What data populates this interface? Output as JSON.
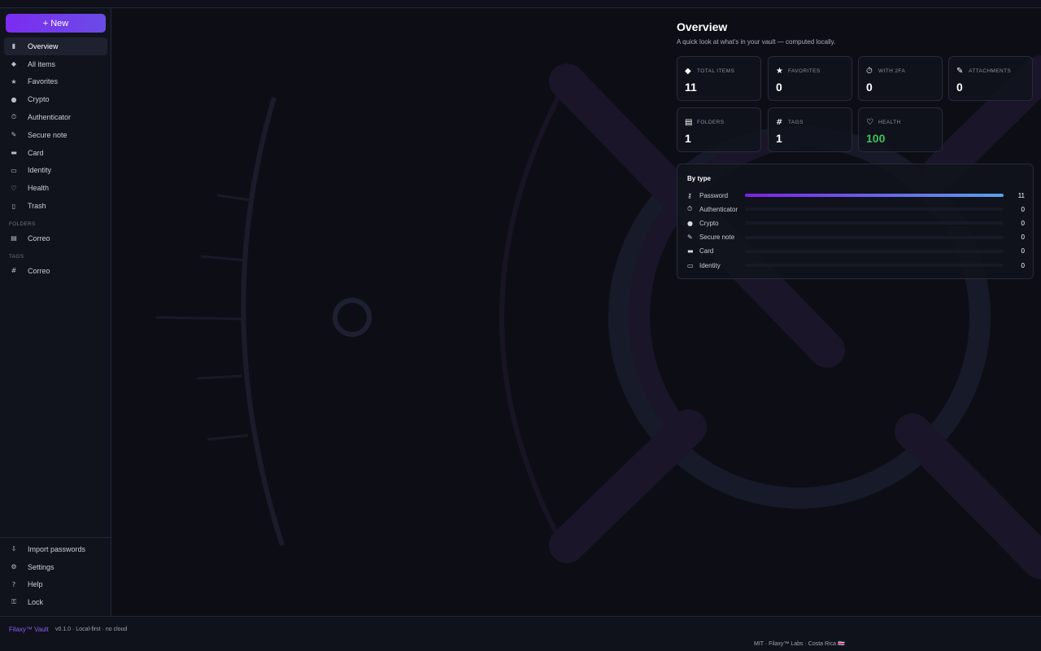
{
  "sidebar": {
    "new_button": "+ New",
    "items": [
      {
        "label": "Overview",
        "icon": "bar-chart-icon",
        "glyph": "▮"
      },
      {
        "label": "All items",
        "icon": "diamond-icon",
        "glyph": "◆"
      },
      {
        "label": "Favorites",
        "icon": "star-icon",
        "glyph": "★"
      },
      {
        "label": "Crypto",
        "icon": "coin-icon",
        "glyph": "●"
      },
      {
        "label": "Authenticator",
        "icon": "stopwatch-icon",
        "glyph": "⏱"
      },
      {
        "label": "Secure note",
        "icon": "memo-icon",
        "glyph": "✎"
      },
      {
        "label": "Card",
        "icon": "credit-card-icon",
        "glyph": "▬"
      },
      {
        "label": "Identity",
        "icon": "id-card-icon",
        "glyph": "▭"
      },
      {
        "label": "Health",
        "icon": "stethoscope-icon",
        "glyph": "♡"
      },
      {
        "label": "Trash",
        "icon": "trash-icon",
        "glyph": "▯"
      }
    ],
    "folders_label": "FOLDERS",
    "folders": [
      {
        "label": "Correo",
        "icon": "folder-icon",
        "glyph": "▤"
      }
    ],
    "tags_label": "TAGS",
    "tags": [
      {
        "label": "Correo",
        "icon": "hash-icon",
        "glyph": "#"
      }
    ],
    "bottom": [
      {
        "label": "Import passwords",
        "icon": "inbox-tray-icon",
        "glyph": "⇩"
      },
      {
        "label": "Settings",
        "icon": "gear-icon",
        "glyph": "⚙"
      },
      {
        "label": "Help",
        "icon": "question-icon",
        "glyph": "?"
      },
      {
        "label": "Lock",
        "icon": "lock-icon",
        "glyph": "⚿"
      }
    ]
  },
  "main": {
    "title": "Overview",
    "subtitle": "A quick look at what's in your vault — computed locally.",
    "stats": [
      {
        "label": "TOTAL ITEMS",
        "value": "11",
        "icon": "diamond-icon",
        "glyph": "◆"
      },
      {
        "label": "FAVORITES",
        "value": "0",
        "icon": "star-icon",
        "glyph": "★"
      },
      {
        "label": "WITH 2FA",
        "value": "0",
        "icon": "stopwatch-icon",
        "glyph": "⏱"
      },
      {
        "label": "ATTACHMENTS",
        "value": "0",
        "icon": "paperclip-icon",
        "glyph": "✎"
      },
      {
        "label": "FOLDERS",
        "value": "1",
        "icon": "folder-icon",
        "glyph": "▤"
      },
      {
        "label": "TAGS",
        "value": "1",
        "icon": "hash-icon",
        "glyph": "#"
      },
      {
        "label": "HEALTH",
        "value": "100",
        "icon": "stethoscope-icon",
        "glyph": "♡"
      }
    ],
    "by_type": {
      "title": "By type",
      "rows": [
        {
          "label": "Password",
          "count": "11",
          "fraction": 1.0,
          "icon": "key-icon",
          "glyph": "⚷"
        },
        {
          "label": "Authenticator",
          "count": "0",
          "fraction": 0,
          "icon": "stopwatch-icon",
          "glyph": "⏱"
        },
        {
          "label": "Crypto",
          "count": "0",
          "fraction": 0,
          "icon": "coin-icon",
          "glyph": "●"
        },
        {
          "label": "Secure note",
          "count": "0",
          "fraction": 0,
          "icon": "memo-icon",
          "glyph": "✎"
        },
        {
          "label": "Card",
          "count": "0",
          "fraction": 0,
          "icon": "credit-card-icon",
          "glyph": "▬"
        },
        {
          "label": "Identity",
          "count": "0",
          "fraction": 0,
          "icon": "id-card-icon",
          "glyph": "▭"
        }
      ]
    }
  },
  "footer": {
    "brand": "Filaxy™ Vault",
    "version": "v0.1.0 · Local-first · no cloud",
    "credit": "MIT · Filaxy™ Labs · Costa Rica 🇨🇷"
  },
  "colors": {
    "accent": "#7c2cf0",
    "health_green": "#3fc25a",
    "background": "#0d0e15"
  }
}
